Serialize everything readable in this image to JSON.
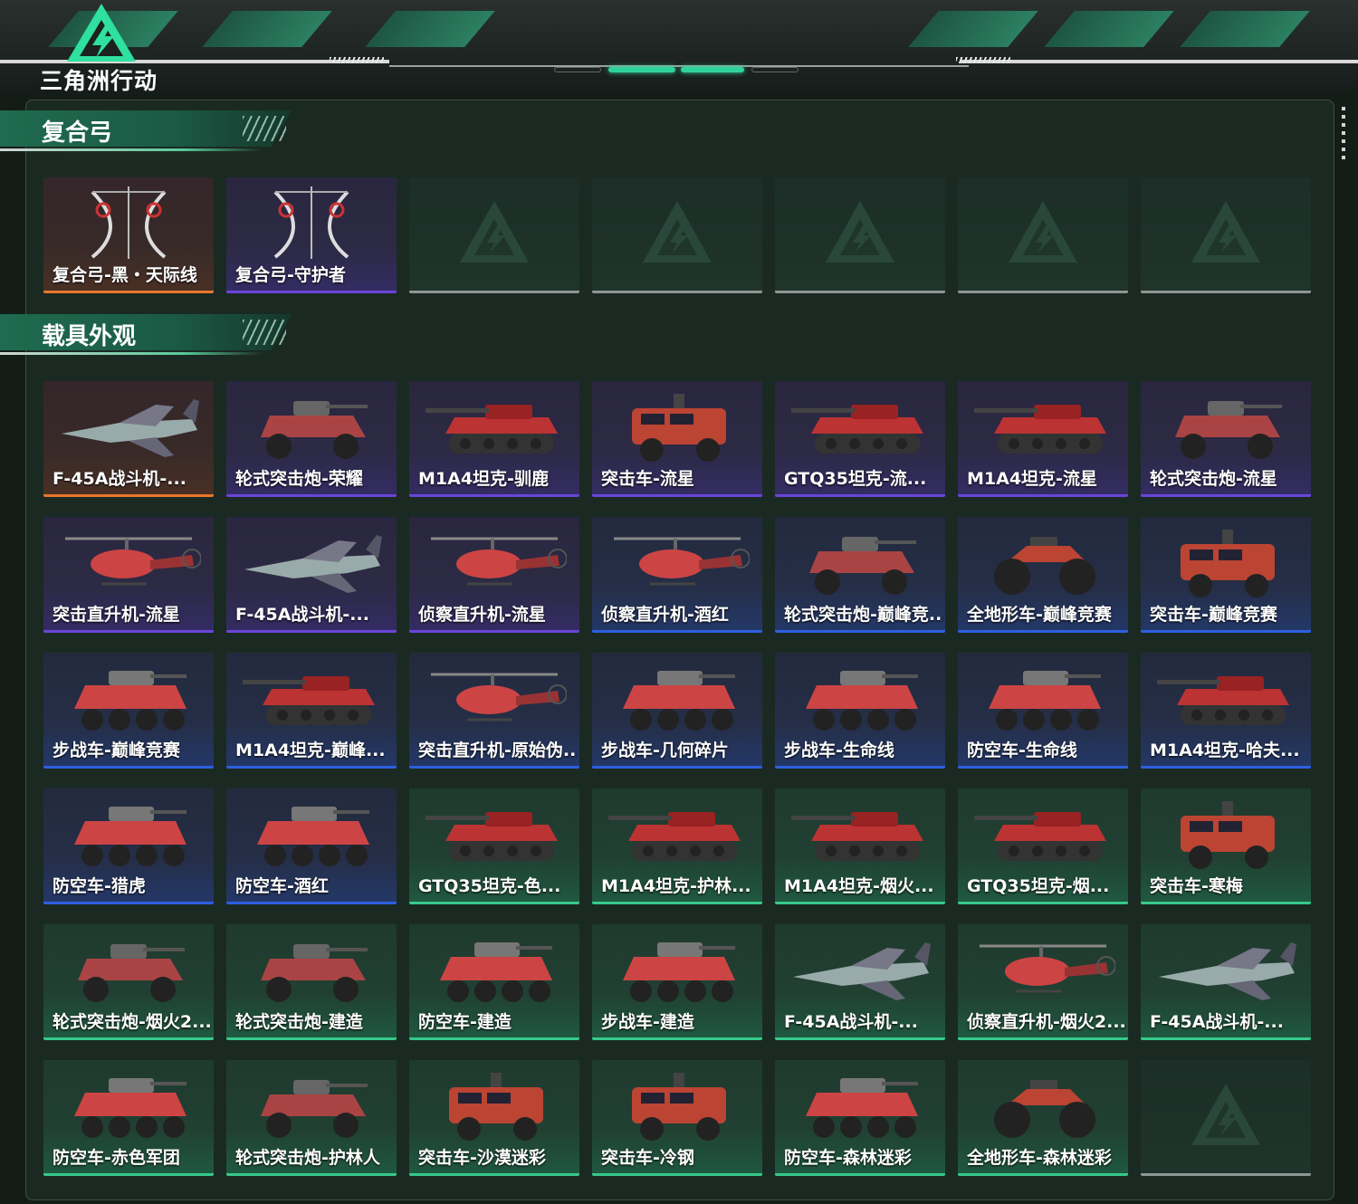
{
  "logo": {
    "text": "三角洲行动"
  },
  "colors": {
    "rarity_orange": "#e9772d",
    "rarity_purple": "#6a44d8",
    "rarity_blue": "#2e5fe0",
    "rarity_green": "#36c98a",
    "accent": "#2fd39a"
  },
  "sections": [
    {
      "title": "复合弓",
      "items": [
        {
          "label": "复合弓-黑・天际线",
          "rarity": "orange",
          "icon": "bow-icon"
        },
        {
          "label": "复合弓-守护者",
          "rarity": "purple",
          "icon": "bow-icon"
        },
        {
          "label": "",
          "rarity": "empty",
          "icon": "locked-slot-icon"
        },
        {
          "label": "",
          "rarity": "empty",
          "icon": "locked-slot-icon"
        },
        {
          "label": "",
          "rarity": "empty",
          "icon": "locked-slot-icon"
        },
        {
          "label": "",
          "rarity": "empty",
          "icon": "locked-slot-icon"
        },
        {
          "label": "",
          "rarity": "empty",
          "icon": "locked-slot-icon"
        }
      ]
    },
    {
      "title": "载具外观",
      "items": [
        {
          "label": "F-45A战斗机-...",
          "rarity": "orange",
          "icon": "jet-icon"
        },
        {
          "label": "轮式突击炮-荣耀",
          "rarity": "purple",
          "icon": "armored-car-icon"
        },
        {
          "label": "M1A4坦克-驯鹿",
          "rarity": "purple",
          "icon": "tank-icon"
        },
        {
          "label": "突击车-流星",
          "rarity": "purple",
          "icon": "truck-icon"
        },
        {
          "label": "GTQ35坦克-流...",
          "rarity": "purple",
          "icon": "tank-icon"
        },
        {
          "label": "M1A4坦克-流星",
          "rarity": "purple",
          "icon": "tank-icon"
        },
        {
          "label": "轮式突击炮-流星",
          "rarity": "purple",
          "icon": "armored-car-icon"
        },
        {
          "label": "突击直升机-流星",
          "rarity": "purple",
          "icon": "helicopter-icon"
        },
        {
          "label": "F-45A战斗机-...",
          "rarity": "purple",
          "icon": "jet-icon"
        },
        {
          "label": "侦察直升机-流星",
          "rarity": "purple",
          "icon": "helicopter-icon"
        },
        {
          "label": "侦察直升机-酒红",
          "rarity": "blue",
          "icon": "helicopter-icon"
        },
        {
          "label": "轮式突击炮-巅峰竞...",
          "rarity": "blue",
          "icon": "armored-car-icon"
        },
        {
          "label": "全地形车-巅峰竞赛",
          "rarity": "blue",
          "icon": "atv-icon"
        },
        {
          "label": "突击车-巅峰竞赛",
          "rarity": "blue",
          "icon": "truck-icon"
        },
        {
          "label": "步战车-巅峰竞赛",
          "rarity": "blue",
          "icon": "ifv-icon"
        },
        {
          "label": "M1A4坦克-巅峰...",
          "rarity": "blue",
          "icon": "tank-icon"
        },
        {
          "label": "突击直升机-原始伪...",
          "rarity": "blue",
          "icon": "helicopter-icon"
        },
        {
          "label": "步战车-几何碎片",
          "rarity": "blue",
          "icon": "ifv-icon"
        },
        {
          "label": "步战车-生命线",
          "rarity": "blue",
          "icon": "ifv-icon"
        },
        {
          "label": "防空车-生命线",
          "rarity": "blue",
          "icon": "ifv-icon"
        },
        {
          "label": "M1A4坦克-哈夫...",
          "rarity": "blue",
          "icon": "tank-icon"
        },
        {
          "label": "防空车-猎虎",
          "rarity": "blue",
          "icon": "ifv-icon"
        },
        {
          "label": "防空车-酒红",
          "rarity": "blue",
          "icon": "ifv-icon"
        },
        {
          "label": "GTQ35坦克-色...",
          "rarity": "green",
          "icon": "tank-icon"
        },
        {
          "label": "M1A4坦克-护林...",
          "rarity": "green",
          "icon": "tank-icon"
        },
        {
          "label": "M1A4坦克-烟火...",
          "rarity": "green",
          "icon": "tank-icon"
        },
        {
          "label": "GTQ35坦克-烟...",
          "rarity": "green",
          "icon": "tank-icon"
        },
        {
          "label": "突击车-寒梅",
          "rarity": "green",
          "icon": "truck-icon"
        },
        {
          "label": "轮式突击炮-烟火2...",
          "rarity": "green",
          "icon": "armored-car-icon"
        },
        {
          "label": "轮式突击炮-建造",
          "rarity": "green",
          "icon": "armored-car-icon"
        },
        {
          "label": "防空车-建造",
          "rarity": "green",
          "icon": "ifv-icon"
        },
        {
          "label": "步战车-建造",
          "rarity": "green",
          "icon": "ifv-icon"
        },
        {
          "label": "F-45A战斗机-...",
          "rarity": "green",
          "icon": "jet-icon"
        },
        {
          "label": "侦察直升机-烟火2...",
          "rarity": "green",
          "icon": "helicopter-icon"
        },
        {
          "label": "F-45A战斗机-...",
          "rarity": "green",
          "icon": "jet-icon"
        },
        {
          "label": "防空车-赤色军团",
          "rarity": "green",
          "icon": "ifv-icon"
        },
        {
          "label": "轮式突击炮-护林人",
          "rarity": "green",
          "icon": "armored-car-icon"
        },
        {
          "label": "突击车-沙漠迷彩",
          "rarity": "green",
          "icon": "truck-icon"
        },
        {
          "label": "突击车-冷钢",
          "rarity": "green",
          "icon": "truck-icon"
        },
        {
          "label": "防空车-森林迷彩",
          "rarity": "green",
          "icon": "ifv-icon"
        },
        {
          "label": "全地形车-森林迷彩",
          "rarity": "green",
          "icon": "atv-icon"
        },
        {
          "label": "",
          "rarity": "empty",
          "icon": "locked-slot-icon"
        }
      ]
    }
  ]
}
